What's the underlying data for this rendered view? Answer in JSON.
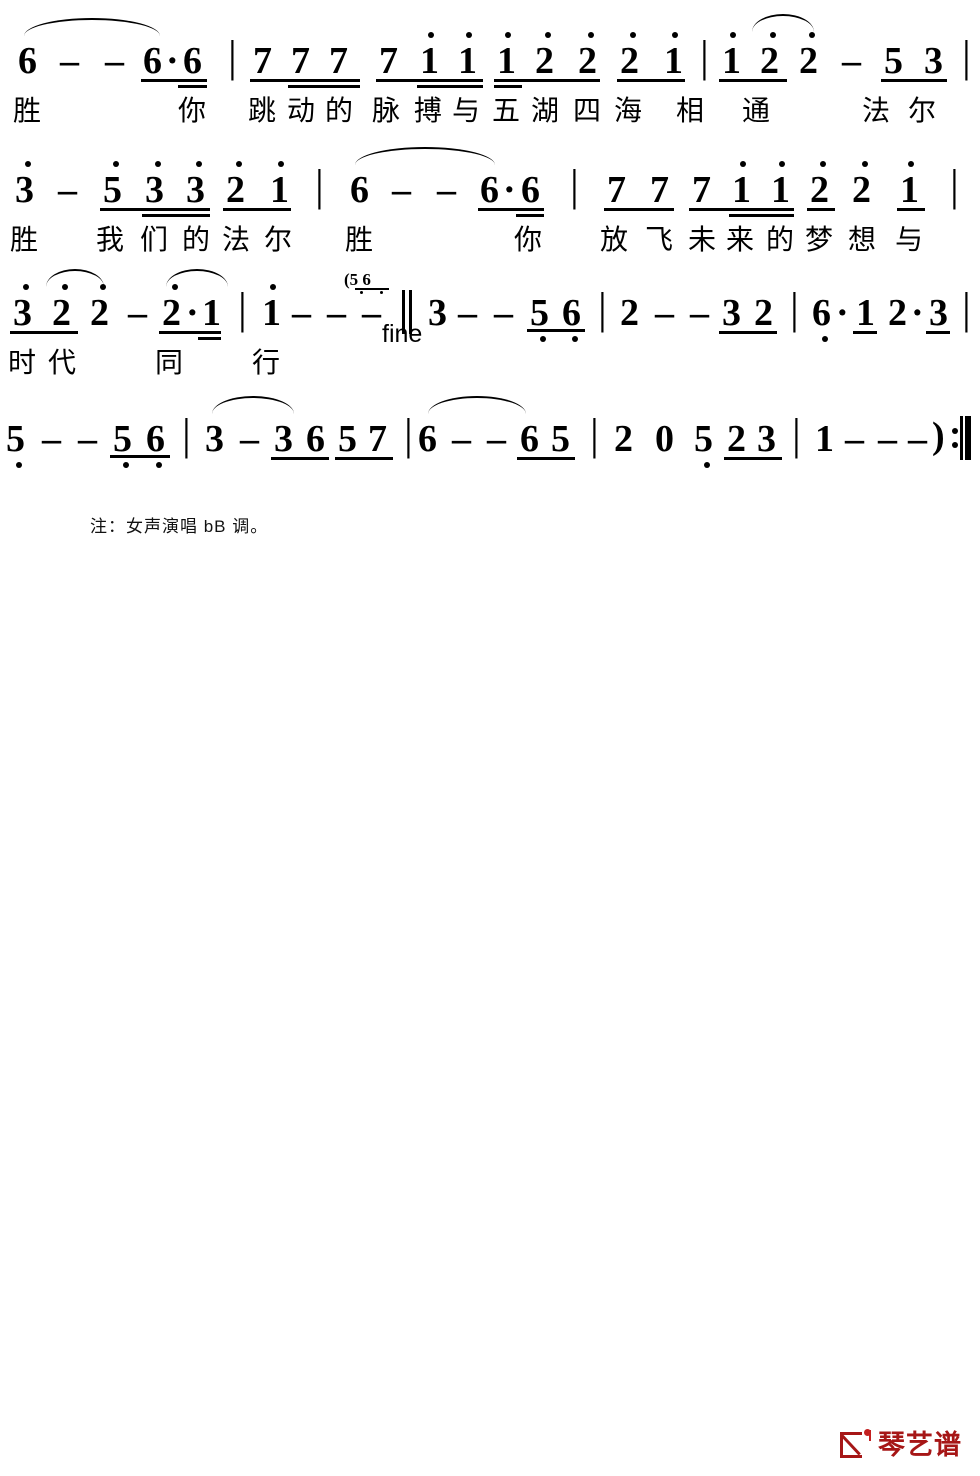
{
  "document": {
    "type": "jianpu-numbered-musical-notation",
    "footnote": "注：女声演唱 bB 调。",
    "fine_marking": "fine",
    "grace_notes": "(5 6",
    "logo_text": "琴艺谱",
    "accent_color": "#a61616"
  },
  "systems": [
    {
      "index": 1,
      "notes": "6 - - 6· 6 | 7 7 7 7 1̇ 1̇ 1̇ 2̇ 2̇ 2̇ 1̇ | 1̇ 2̇ 2̇ - 5 3 |",
      "lyrics": [
        "胜",
        "你",
        "跳",
        "动",
        "的",
        "脉",
        "搏",
        "与",
        "五",
        "湖",
        "四",
        "海",
        "相",
        "通",
        "法",
        "尔"
      ],
      "measures": [
        {
          "notes": [
            "6",
            "-",
            "-",
            "6·",
            "6"
          ],
          "slur": true
        },
        {
          "notes": [
            "7",
            "7",
            "7",
            "7",
            "1̇",
            "1̇",
            "1̇",
            "2̇",
            "2̇",
            "2̇",
            "1̇"
          ]
        },
        {
          "notes": [
            "1̇",
            "2̇",
            "2̇",
            "-",
            "5",
            "3"
          ],
          "slur": true
        }
      ]
    },
    {
      "index": 2,
      "notes": "3̇ - 5̇ 3̇ 3̇ 2̇ 1̇ | 6 - - 6· 6 | 7 7 7 1̇ 1̇ 2̇ 2̇ 1̇ |",
      "lyrics": [
        "胜",
        "我",
        "们",
        "的",
        "法",
        "尔",
        "胜",
        "你",
        "放",
        "飞",
        "未",
        "来",
        "的",
        "梦",
        "想",
        "与"
      ],
      "measures": [
        {
          "notes": [
            "3̇",
            "-",
            "5̇",
            "3̇",
            "3̇",
            "2̇",
            "1̇"
          ]
        },
        {
          "notes": [
            "6",
            "-",
            "-",
            "6·",
            "6"
          ],
          "slur": true
        },
        {
          "notes": [
            "7",
            "7",
            "7",
            "1̇",
            "1̇",
            "2̇",
            "2̇",
            "1̇"
          ]
        }
      ]
    },
    {
      "index": 3,
      "notes": "3̇ 2̇ 2̇ - 2̇· 1̇ | 1̇ - - - ‖ 3 - - 5̣ 6̣ | 2 - - 3 2 | 6̣· 1 2· 3 |",
      "lyrics": [
        "时",
        "代",
        "同",
        "行"
      ],
      "measures": [
        {
          "notes": [
            "3̇",
            "2̇",
            "2̇",
            "-",
            "2̇·",
            "1̇"
          ],
          "slur": true
        },
        {
          "notes": [
            "1̇",
            "-",
            "-",
            "-"
          ],
          "end": "double-barline",
          "annotation": "(5 6",
          "marking": "fine"
        },
        {
          "notes": [
            "3",
            "-",
            "-",
            "5̣",
            "6̣"
          ]
        },
        {
          "notes": [
            "2",
            "-",
            "-",
            "3",
            "2"
          ]
        },
        {
          "notes": [
            "6̣·",
            "1",
            "2·",
            "3"
          ]
        }
      ]
    },
    {
      "index": 4,
      "notes": "5̣ - - 5̣ 6̣ | 3 - 3 6 5 7 | 6 - - 6 5 | 2 0 5̣ 2 3 | 1 - - - ) :‖",
      "lyrics": [],
      "measures": [
        {
          "notes": [
            "5̣",
            "-",
            "-",
            "5̣",
            "6̣"
          ]
        },
        {
          "notes": [
            "3",
            "-",
            "3",
            "6",
            "5",
            "7"
          ],
          "slur": true
        },
        {
          "notes": [
            "6",
            "-",
            "-",
            "6",
            "5"
          ],
          "slur": true
        },
        {
          "notes": [
            "2",
            "0",
            "5̣",
            "2",
            "3"
          ]
        },
        {
          "notes": [
            "1",
            "-",
            "-",
            "-",
            ")"
          ],
          "end": "repeat-end"
        }
      ]
    }
  ]
}
